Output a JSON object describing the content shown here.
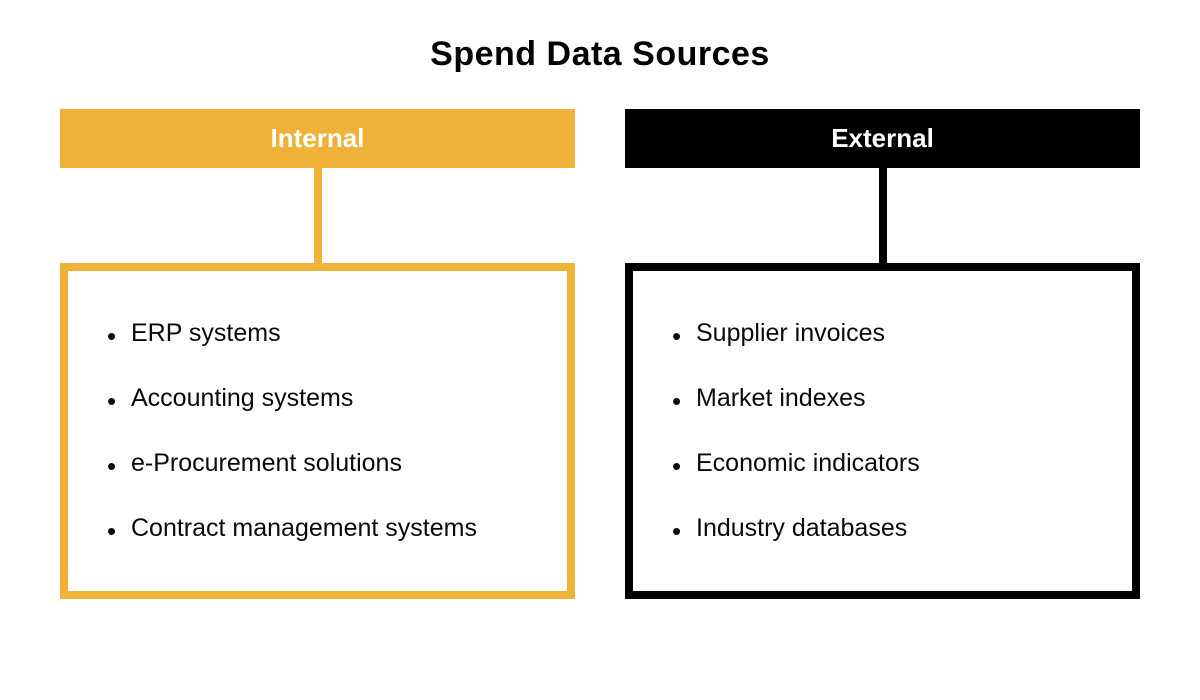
{
  "title": "Spend Data Sources",
  "columns": {
    "internal": {
      "header": "Internal",
      "color": "#f0b138",
      "items": [
        "ERP systems",
        "Accounting systems",
        "e-Procurement solutions",
        "Contract management systems"
      ]
    },
    "external": {
      "header": "External",
      "color": "#000000",
      "items": [
        "Supplier invoices",
        "Market indexes",
        "Economic indicators",
        "Industry databases"
      ]
    }
  }
}
